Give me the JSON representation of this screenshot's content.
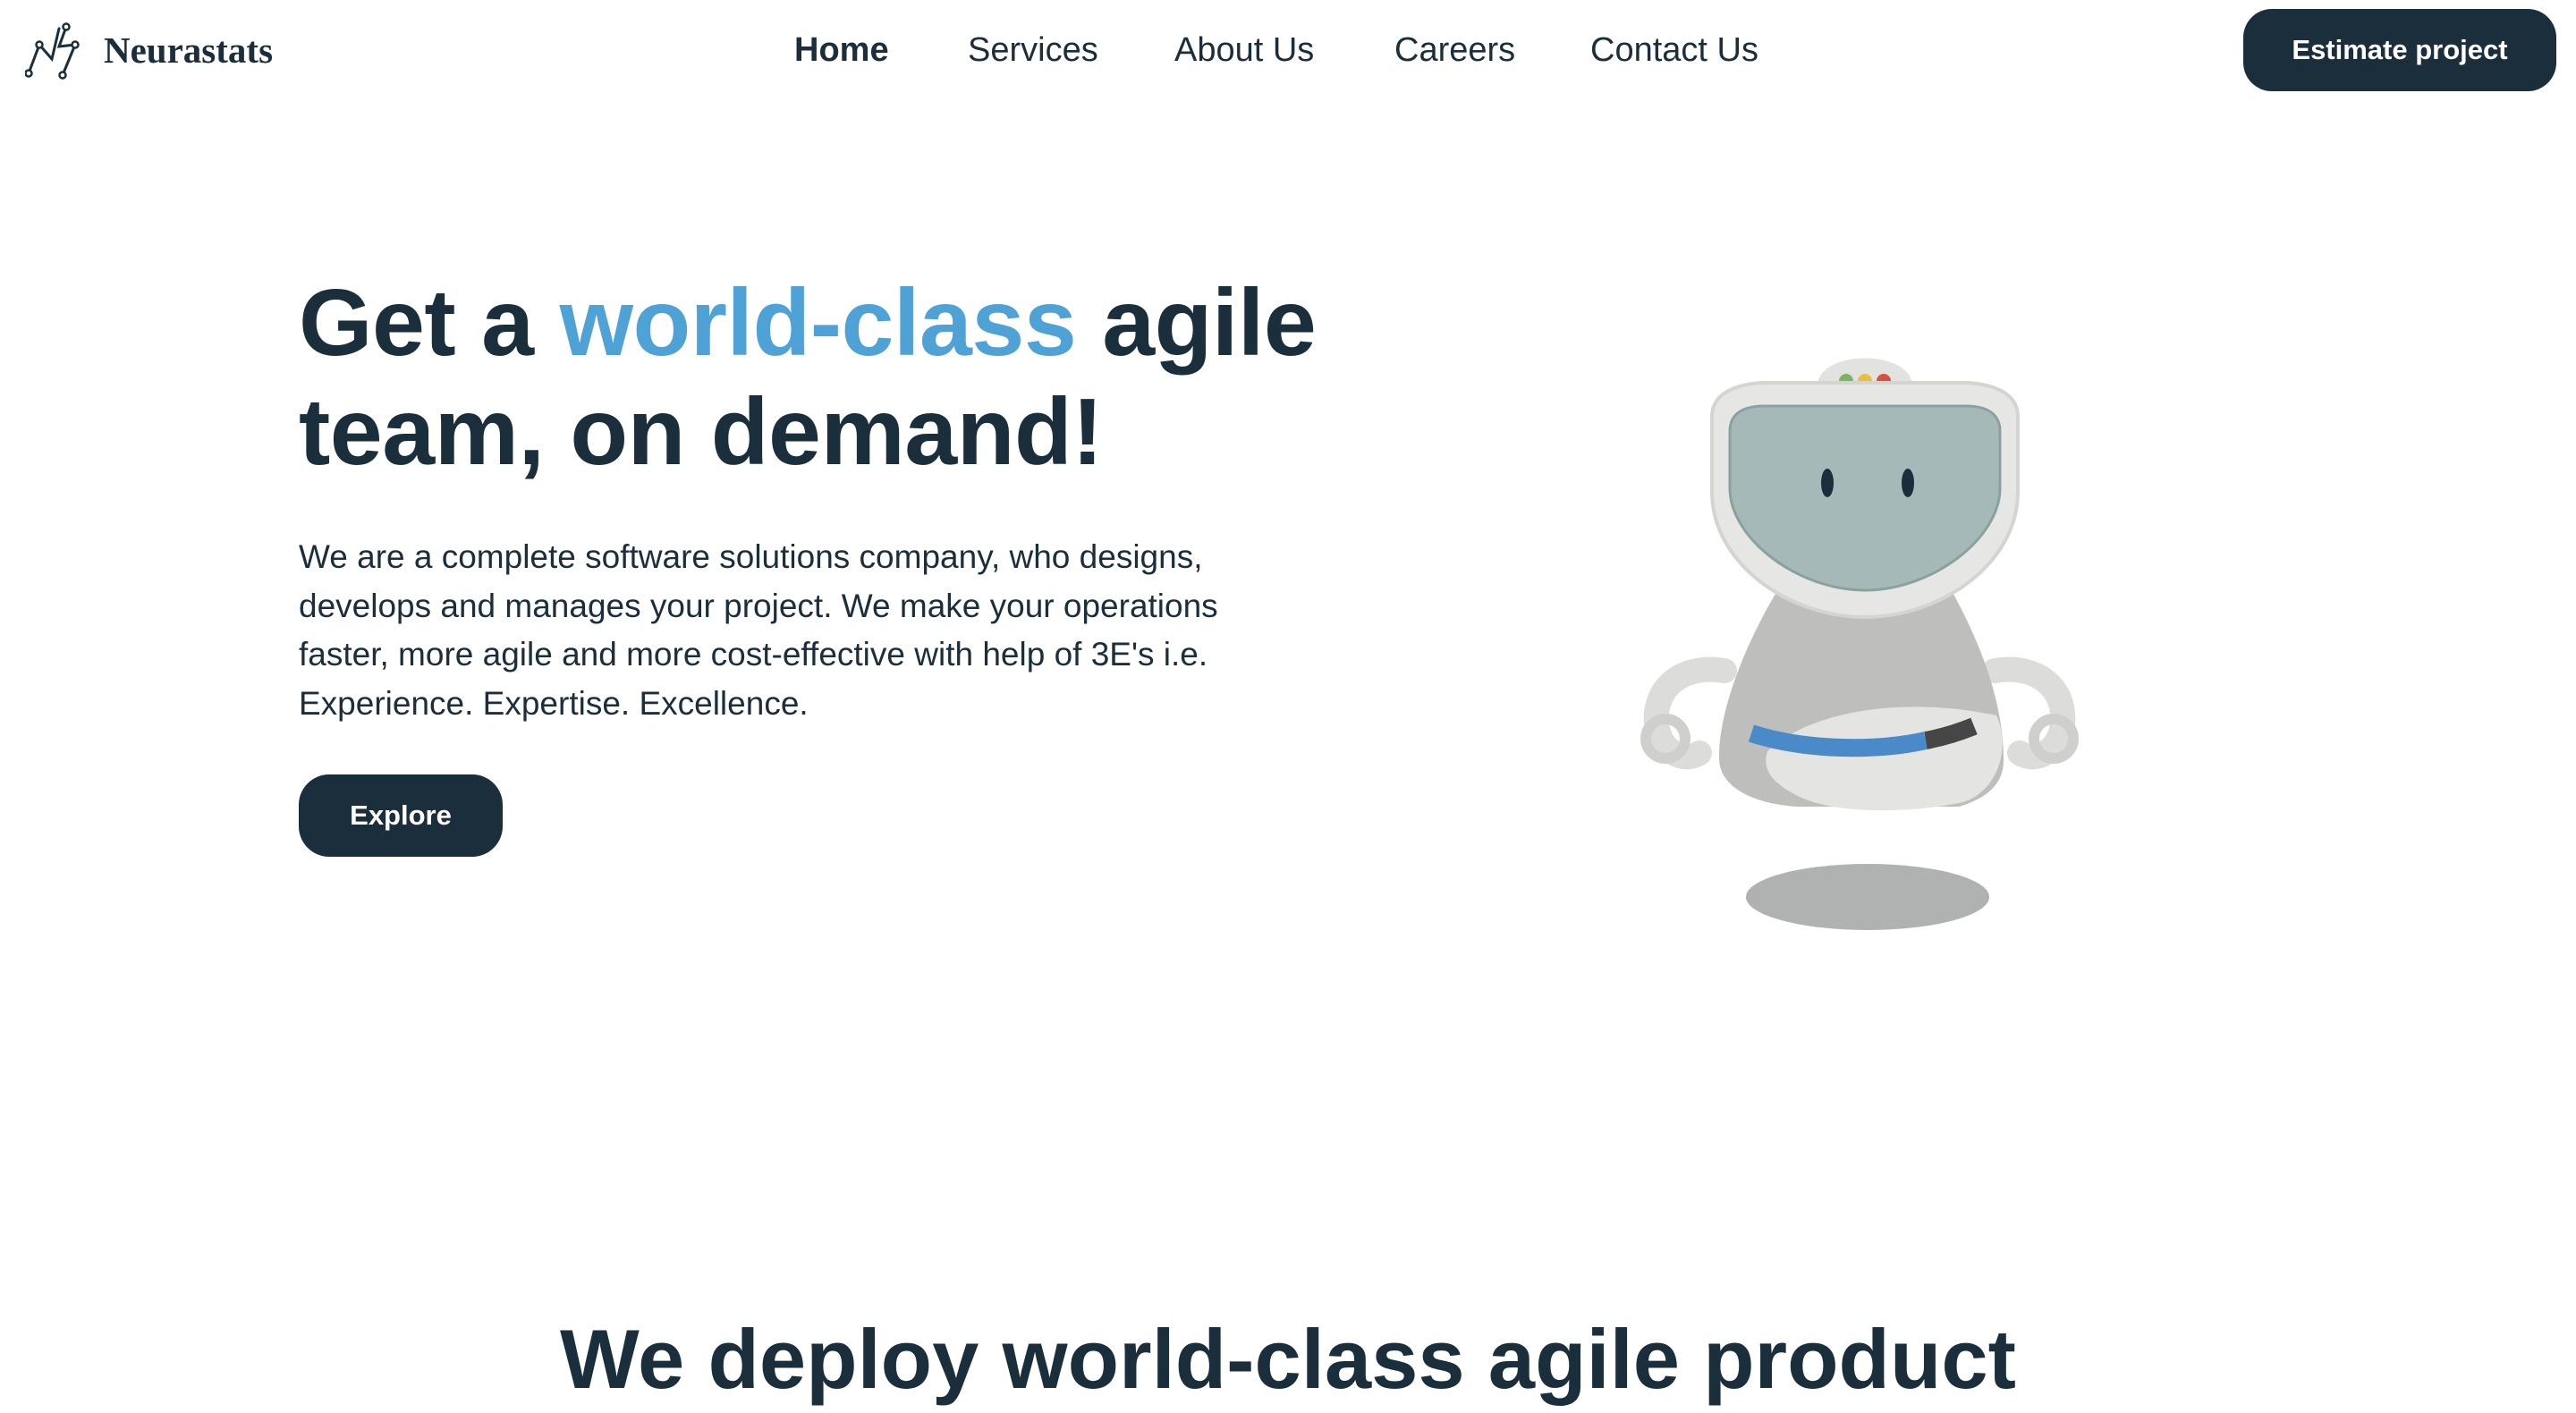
{
  "brand": {
    "name": "Neurastats"
  },
  "nav": {
    "items": [
      {
        "label": "Home",
        "active": true
      },
      {
        "label": "Services"
      },
      {
        "label": "About Us"
      },
      {
        "label": "Careers"
      },
      {
        "label": "Contact Us"
      }
    ],
    "cta_label": "Estimate project"
  },
  "hero": {
    "title_part1": "Get a ",
    "title_accent": "world-class",
    "title_part2": " agile team, on demand!",
    "description": "We are a complete software solutions company, who designs, develops and manages your project. We make your operations faster, more agile and more cost-effective with help of 3E's i.e. Experience. Expertise. Excellence.",
    "button_label": "Explore",
    "illustration": "robot-mascot"
  },
  "next_section": {
    "title": "We deploy world-class agile product"
  },
  "colors": {
    "primary": "#1b2e3c",
    "accent": "#4ea2d6",
    "background": "#ffffff"
  }
}
